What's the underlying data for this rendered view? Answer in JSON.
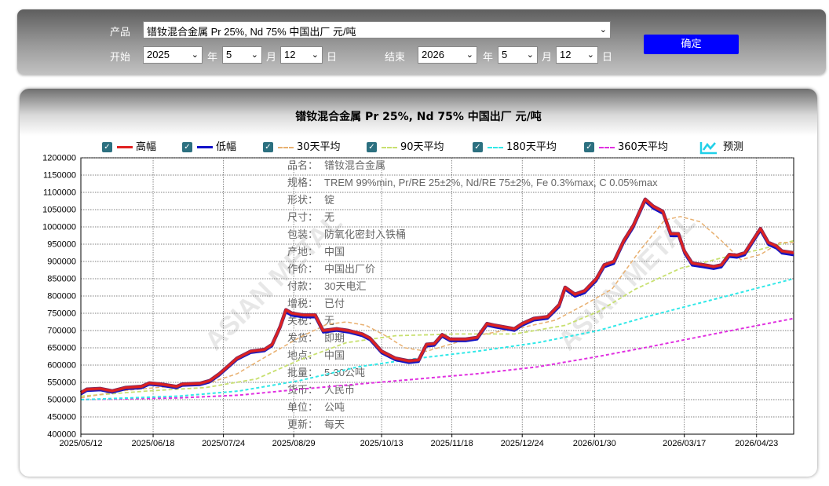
{
  "form": {
    "product_label": "产品",
    "product_value": "镨钕混合金属 Pr 25%, Nd 75% 中国出厂 元/吨",
    "start_label": "开始",
    "start_year": "2025",
    "start_month": "5",
    "start_day": "12",
    "end_label": "结束",
    "end_year": "2026",
    "end_month": "5",
    "end_day": "12",
    "year_unit": "年",
    "month_unit": "月",
    "day_unit": "日",
    "confirm_label": "确定"
  },
  "legend": {
    "high": "高幅",
    "low": "低幅",
    "ma30": "30天平均",
    "ma90": "90天平均",
    "ma180": "180天平均",
    "ma360": "360天平均",
    "forecast": "预测"
  },
  "info": [
    {
      "k": "品名：",
      "v": "镨钕混合金属"
    },
    {
      "k": "规格：",
      "v": "TREM 99%min, Pr/RE 25±2%, Nd/RE 75±2%, Fe 0.3%max, C 0.05%max"
    },
    {
      "k": "形状：",
      "v": "锭"
    },
    {
      "k": "尺寸：",
      "v": "无"
    },
    {
      "k": "包装：",
      "v": "防氧化密封入铁桶"
    },
    {
      "k": "产地：",
      "v": "中国"
    },
    {
      "k": "作价：",
      "v": "中国出厂价"
    },
    {
      "k": "付款：",
      "v": "30天电汇"
    },
    {
      "k": "增税：",
      "v": "已付"
    },
    {
      "k": "关税：",
      "v": "无"
    },
    {
      "k": "发货：",
      "v": "即期"
    },
    {
      "k": "地点：",
      "v": "中国"
    },
    {
      "k": "批量：",
      "v": "5-30公吨"
    },
    {
      "k": "货币：",
      "v": "人民币"
    },
    {
      "k": "单位：",
      "v": "公吨"
    },
    {
      "k": "更新：",
      "v": "每天"
    }
  ],
  "colors": {
    "high": "#e02020",
    "low": "#1010c8",
    "ma30": "#e8b070",
    "ma90": "#c8e070",
    "ma180": "#30e8e8",
    "ma360": "#e030e0"
  },
  "chart_data": {
    "type": "line",
    "title": "镨钕混合金属 Pr 25%, Nd 75% 中国出厂 元/吨",
    "x_ticks": [
      "2025/05/12",
      "2025/06/18",
      "2025/07/24",
      "2025/08/29",
      "2025/10/13",
      "2025/11/18",
      "2025/12/24",
      "2026/01/30",
      "2026/03/17",
      "2026/04/23"
    ],
    "y_ticks": [
      400000,
      450000,
      500000,
      550000,
      600000,
      650000,
      700000,
      750000,
      800000,
      850000,
      900000,
      950000,
      1000000,
      1050000,
      1100000,
      1150000,
      1200000
    ],
    "ylim": [
      400000,
      1200000
    ],
    "xlim": [
      "2025/05/12",
      "2026/05/12"
    ],
    "grid": true,
    "legend_position": "top",
    "series": [
      {
        "name": "高幅",
        "points": [
          [
            "2025/05/12",
            520000
          ],
          [
            "2025/05/15",
            530000
          ],
          [
            "2025/05/22",
            532000
          ],
          [
            "2025/05/28",
            525000
          ],
          [
            "2025/06/04",
            535000
          ],
          [
            "2025/06/12",
            538000
          ],
          [
            "2025/06/16",
            548000
          ],
          [
            "2025/06/22",
            545000
          ],
          [
            "2025/06/30",
            538000
          ],
          [
            "2025/07/03",
            545000
          ],
          [
            "2025/07/12",
            547000
          ],
          [
            "2025/07/17",
            555000
          ],
          [
            "2025/07/22",
            575000
          ],
          [
            "2025/07/25",
            590000
          ],
          [
            "2025/07/31",
            620000
          ],
          [
            "2025/08/07",
            640000
          ],
          [
            "2025/08/14",
            645000
          ],
          [
            "2025/08/18",
            660000
          ],
          [
            "2025/08/22",
            710000
          ],
          [
            "2025/08/25",
            760000
          ],
          [
            "2025/08/28",
            750000
          ],
          [
            "2025/09/03",
            745000
          ],
          [
            "2025/09/09",
            745000
          ],
          [
            "2025/09/13",
            700000
          ],
          [
            "2025/09/20",
            705000
          ],
          [
            "2025/09/26",
            700000
          ],
          [
            "2025/10/03",
            690000
          ],
          [
            "2025/10/07",
            678000
          ],
          [
            "2025/10/13",
            640000
          ],
          [
            "2025/10/20",
            620000
          ],
          [
            "2025/10/27",
            612000
          ],
          [
            "2025/11/01",
            615000
          ],
          [
            "2025/11/05",
            660000
          ],
          [
            "2025/11/09",
            662000
          ],
          [
            "2025/11/13",
            688000
          ],
          [
            "2025/11/17",
            675000
          ],
          [
            "2025/11/25",
            675000
          ],
          [
            "2025/12/01",
            680000
          ],
          [
            "2025/12/06",
            720000
          ],
          [
            "2025/12/10",
            715000
          ],
          [
            "2025/12/20",
            705000
          ],
          [
            "2025/12/24",
            720000
          ],
          [
            "2025/12/30",
            735000
          ],
          [
            "2026/01/06",
            740000
          ],
          [
            "2026/01/12",
            775000
          ],
          [
            "2026/01/15",
            825000
          ],
          [
            "2026/01/20",
            805000
          ],
          [
            "2026/01/25",
            815000
          ],
          [
            "2026/01/31",
            850000
          ],
          [
            "2026/02/04",
            890000
          ],
          [
            "2026/02/09",
            900000
          ],
          [
            "2026/02/14",
            960000
          ],
          [
            "2026/02/19",
            1005000
          ],
          [
            "2026/02/25",
            1080000
          ],
          [
            "2026/03/01",
            1060000
          ],
          [
            "2026/03/06",
            1045000
          ],
          [
            "2026/03/10",
            980000
          ],
          [
            "2026/03/14",
            980000
          ],
          [
            "2026/03/17",
            930000
          ],
          [
            "2026/03/21",
            895000
          ],
          [
            "2026/03/27",
            890000
          ],
          [
            "2026/04/01",
            885000
          ],
          [
            "2026/04/05",
            890000
          ],
          [
            "2026/04/09",
            920000
          ],
          [
            "2026/04/13",
            918000
          ],
          [
            "2026/04/17",
            925000
          ],
          [
            "2026/04/21",
            960000
          ],
          [
            "2026/04/25",
            995000
          ],
          [
            "2026/04/29",
            955000
          ],
          [
            "2026/05/03",
            945000
          ],
          [
            "2026/05/06",
            930000
          ],
          [
            "2026/05/12",
            925000
          ]
        ]
      },
      {
        "name": "低幅",
        "points": [
          [
            "2025/05/12",
            515000
          ],
          [
            "2025/05/15",
            525000
          ],
          [
            "2025/05/22",
            527000
          ],
          [
            "2025/05/28",
            520000
          ],
          [
            "2025/06/04",
            530000
          ],
          [
            "2025/06/12",
            533000
          ],
          [
            "2025/06/16",
            543000
          ],
          [
            "2025/06/22",
            540000
          ],
          [
            "2025/06/30",
            533000
          ],
          [
            "2025/07/03",
            540000
          ],
          [
            "2025/07/12",
            542000
          ],
          [
            "2025/07/17",
            550000
          ],
          [
            "2025/07/22",
            570000
          ],
          [
            "2025/07/25",
            585000
          ],
          [
            "2025/07/31",
            615000
          ],
          [
            "2025/08/07",
            635000
          ],
          [
            "2025/08/14",
            640000
          ],
          [
            "2025/08/18",
            655000
          ],
          [
            "2025/08/22",
            705000
          ],
          [
            "2025/08/25",
            752000
          ],
          [
            "2025/08/28",
            743000
          ],
          [
            "2025/09/03",
            738000
          ],
          [
            "2025/09/09",
            738000
          ],
          [
            "2025/09/13",
            694000
          ],
          [
            "2025/09/20",
            699000
          ],
          [
            "2025/09/26",
            694000
          ],
          [
            "2025/10/03",
            684000
          ],
          [
            "2025/10/07",
            672000
          ],
          [
            "2025/10/13",
            634000
          ],
          [
            "2025/10/20",
            614000
          ],
          [
            "2025/10/27",
            606000
          ],
          [
            "2025/11/01",
            609000
          ],
          [
            "2025/11/05",
            654000
          ],
          [
            "2025/11/09",
            656000
          ],
          [
            "2025/11/13",
            682000
          ],
          [
            "2025/11/17",
            669000
          ],
          [
            "2025/11/25",
            669000
          ],
          [
            "2025/12/01",
            674000
          ],
          [
            "2025/12/06",
            714000
          ],
          [
            "2025/12/10",
            709000
          ],
          [
            "2025/12/20",
            699000
          ],
          [
            "2025/12/24",
            714000
          ],
          [
            "2025/12/30",
            729000
          ],
          [
            "2026/01/06",
            734000
          ],
          [
            "2026/01/12",
            768000
          ],
          [
            "2026/01/15",
            818000
          ],
          [
            "2026/01/20",
            798000
          ],
          [
            "2026/01/25",
            808000
          ],
          [
            "2026/01/31",
            843000
          ],
          [
            "2026/02/04",
            883000
          ],
          [
            "2026/02/09",
            893000
          ],
          [
            "2026/02/14",
            953000
          ],
          [
            "2026/02/19",
            998000
          ],
          [
            "2026/02/25",
            1073000
          ],
          [
            "2026/03/01",
            1053000
          ],
          [
            "2026/03/06",
            1038000
          ],
          [
            "2026/03/10",
            973000
          ],
          [
            "2026/03/14",
            973000
          ],
          [
            "2026/03/17",
            923000
          ],
          [
            "2026/03/21",
            888000
          ],
          [
            "2026/03/27",
            883000
          ],
          [
            "2026/04/01",
            878000
          ],
          [
            "2026/04/05",
            883000
          ],
          [
            "2026/04/09",
            913000
          ],
          [
            "2026/04/13",
            911000
          ],
          [
            "2026/04/17",
            918000
          ],
          [
            "2026/04/21",
            953000
          ],
          [
            "2026/04/25",
            988000
          ],
          [
            "2026/04/29",
            948000
          ],
          [
            "2026/05/03",
            938000
          ],
          [
            "2026/05/06",
            923000
          ],
          [
            "2026/05/12",
            918000
          ]
        ]
      },
      {
        "name": "30天平均",
        "points": [
          [
            "2025/05/12",
            505000
          ],
          [
            "2025/06/01",
            525000
          ],
          [
            "2025/06/20",
            535000
          ],
          [
            "2025/07/15",
            545000
          ],
          [
            "2025/07/31",
            575000
          ],
          [
            "2025/08/15",
            625000
          ],
          [
            "2025/09/01",
            680000
          ],
          [
            "2025/09/15",
            718000
          ],
          [
            "2025/09/25",
            725000
          ],
          [
            "2025/10/05",
            715000
          ],
          [
            "2025/10/15",
            685000
          ],
          [
            "2025/10/25",
            650000
          ],
          [
            "2025/11/05",
            640000
          ],
          [
            "2025/11/20",
            665000
          ],
          [
            "2025/12/05",
            690000
          ],
          [
            "2025/12/25",
            710000
          ],
          [
            "2026/01/10",
            730000
          ],
          [
            "2026/01/25",
            775000
          ],
          [
            "2026/02/08",
            820000
          ],
          [
            "2026/02/22",
            930000
          ],
          [
            "2026/03/07",
            1020000
          ],
          [
            "2026/03/15",
            1030000
          ],
          [
            "2026/03/25",
            1015000
          ],
          [
            "2026/04/05",
            960000
          ],
          [
            "2026/04/15",
            905000
          ],
          [
            "2026/04/25",
            920000
          ],
          [
            "2026/05/05",
            955000
          ],
          [
            "2026/05/12",
            955000
          ]
        ]
      },
      {
        "name": "90天平均",
        "points": [
          [
            "2025/05/12",
            510000
          ],
          [
            "2025/06/15",
            525000
          ],
          [
            "2025/07/15",
            535000
          ],
          [
            "2025/08/10",
            560000
          ],
          [
            "2025/09/01",
            615000
          ],
          [
            "2025/09/25",
            665000
          ],
          [
            "2025/10/20",
            685000
          ],
          [
            "2025/11/20",
            690000
          ],
          [
            "2025/12/20",
            690000
          ],
          [
            "2026/01/15",
            715000
          ],
          [
            "2026/02/01",
            755000
          ],
          [
            "2026/02/20",
            820000
          ],
          [
            "2026/03/15",
            880000
          ],
          [
            "2026/04/05",
            910000
          ],
          [
            "2026/04/25",
            935000
          ],
          [
            "2026/05/12",
            960000
          ]
        ]
      },
      {
        "name": "180天平均",
        "points": [
          [
            "2025/05/12",
            500000
          ],
          [
            "2025/07/01",
            510000
          ],
          [
            "2025/08/01",
            525000
          ],
          [
            "2025/09/01",
            555000
          ],
          [
            "2025/10/01",
            595000
          ],
          [
            "2025/11/01",
            620000
          ],
          [
            "2025/12/01",
            640000
          ],
          [
            "2026/01/01",
            665000
          ],
          [
            "2026/02/01",
            700000
          ],
          [
            "2026/03/01",
            745000
          ],
          [
            "2026/04/01",
            790000
          ],
          [
            "2026/05/12",
            850000
          ]
        ]
      },
      {
        "name": "360天平均",
        "points": [
          [
            "2025/05/12",
            500000
          ],
          [
            "2025/07/01",
            505000
          ],
          [
            "2025/08/01",
            513000
          ],
          [
            "2025/09/01",
            530000
          ],
          [
            "2025/10/01",
            545000
          ],
          [
            "2025/11/01",
            560000
          ],
          [
            "2025/12/01",
            575000
          ],
          [
            "2026/01/01",
            595000
          ],
          [
            "2026/02/01",
            625000
          ],
          [
            "2026/03/01",
            655000
          ],
          [
            "2026/04/01",
            690000
          ],
          [
            "2026/05/12",
            735000
          ]
        ]
      }
    ]
  }
}
